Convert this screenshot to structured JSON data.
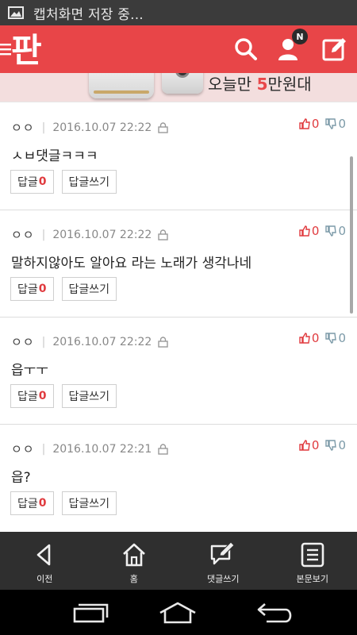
{
  "status_bar": {
    "notification_icon": "image-icon",
    "text": "캡처화면 저장 중..."
  },
  "app_bar": {
    "logo_text": "판",
    "notification_badge": "N",
    "accent_color": "#e84548"
  },
  "banner": {
    "text_prefix": "오늘만 ",
    "text_number": "5",
    "text_suffix": "만원대"
  },
  "comments": [
    {
      "author": "ㅇㅇ",
      "date": "2016.10.07 22:22",
      "likes": "0",
      "dislikes": "0",
      "text": "ㅅㅂ댓글ㅋㅋㅋ",
      "reply_label": "답글",
      "reply_count": "0",
      "write_reply_label": "답글쓰기"
    },
    {
      "author": "ㅇㅇ",
      "date": "2016.10.07 22:22",
      "likes": "0",
      "dislikes": "0",
      "text": "말하지않아도 알아요 라는 노래가 생각나네",
      "reply_label": "답글",
      "reply_count": "0",
      "write_reply_label": "답글쓰기"
    },
    {
      "author": "ㅇㅇ",
      "date": "2016.10.07 22:22",
      "likes": "0",
      "dislikes": "0",
      "text": "읍ㅜㅜ",
      "reply_label": "답글",
      "reply_count": "0",
      "write_reply_label": "답글쓰기"
    },
    {
      "author": "ㅇㅇ",
      "date": "2016.10.07 22:21",
      "likes": "0",
      "dislikes": "0",
      "text": "읍?",
      "reply_label": "답글",
      "reply_count": "0",
      "write_reply_label": "답글쓰기"
    }
  ],
  "toolbar": {
    "items": [
      {
        "label": "이전",
        "icon": "back-triangle-icon"
      },
      {
        "label": "홈",
        "icon": "home-icon"
      },
      {
        "label": "댓글쓰기",
        "icon": "write-comment-icon"
      },
      {
        "label": "본문보기",
        "icon": "document-icon"
      }
    ]
  },
  "nav_bar": {
    "buttons": [
      "recent-apps-icon",
      "home-icon",
      "back-icon"
    ]
  }
}
